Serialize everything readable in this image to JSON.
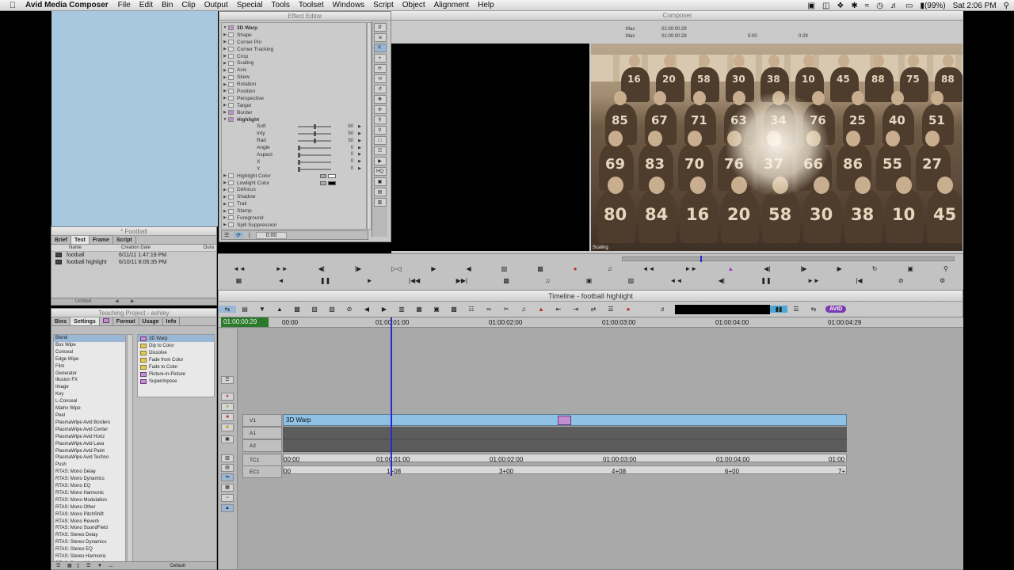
{
  "menubar": {
    "app_name": "Avid Media Composer",
    "items": [
      "File",
      "Edit",
      "Bin",
      "Clip",
      "Output",
      "Special",
      "Tools",
      "Toolset",
      "Windows",
      "Script",
      "Object",
      "Alignment",
      "Help"
    ],
    "battery": "(99%)",
    "clock": "Sat 2:06 PM"
  },
  "bin": {
    "title": "* Football",
    "tabs": [
      "Brief",
      "Text",
      "Frame",
      "Script"
    ],
    "columns": [
      "Name",
      "Creation Date",
      "Dura"
    ],
    "rows": [
      {
        "name": "football",
        "date": "6/11/11 1:47:19 PM"
      },
      {
        "name": "football highlight",
        "date": "6/10/11 8:05:35 PM"
      }
    ],
    "status": "Untitled"
  },
  "project": {
    "title": "Teaching Project - ashley",
    "tabs": [
      "Bins",
      "Settings",
      "",
      "Format",
      "Usage",
      "Info"
    ],
    "categories": [
      "Blend",
      "Box Wipe",
      "Conceal",
      "Edge Wipe",
      "Film",
      "Generator",
      "Illusion FX",
      "Image",
      "Key",
      "L-Conceal",
      "Matrix Wipe",
      "Peel",
      "PlasmaWipe Avid Borders",
      "PlasmaWipe Avid Center",
      "PlasmaWipe Avid Horiz",
      "PlasmaWipe Avid Lava",
      "PlasmaWipe Avid Paint",
      "PlasmaWipe Avid Techno",
      "Push",
      "RTAS: Mono Delay",
      "RTAS: Mono Dynamics",
      "RTAS: Mono EQ",
      "RTAS: Mono Harmonic",
      "RTAS: Mono Modulation",
      "RTAS: Mono Other",
      "RTAS: Mono PitchShift",
      "RTAS: Mono Reverb",
      "RTAS: Mono SoundField",
      "RTAS: Stereo Delay",
      "RTAS: Stereo Dynamics",
      "RTAS: Stereo EQ",
      "RTAS: Stereo Harmonic",
      "RTAS: Stereo Modulation"
    ],
    "effects": [
      "3D Warp",
      "Dip to Color",
      "Dissolve",
      "Fade from Color",
      "Fade to Color",
      "Picture-in-Picture",
      "Superimpose"
    ],
    "footer": "Default"
  },
  "effect_editor": {
    "title": "Effect Editor",
    "effect_name": "3D Warp",
    "params": [
      "Shape",
      "Corner Pin",
      "Corner Tracking",
      "Crop",
      "Scaling",
      "Axis",
      "Skew",
      "Rotation",
      "Position",
      "Perspective",
      "Target",
      "Border"
    ],
    "highlight_label": "Highlight",
    "highlight_params": [
      {
        "name": "Soft",
        "value": "50"
      },
      {
        "name": "Inty",
        "value": "50"
      },
      {
        "name": "Rad",
        "value": "50"
      },
      {
        "name": "Angle",
        "value": "0"
      },
      {
        "name": "Aspect",
        "value": "0"
      },
      {
        "name": "X",
        "value": "0"
      },
      {
        "name": "Y",
        "value": "0"
      }
    ],
    "more_params": [
      "Highlight Color",
      "Lowlight Color",
      "Defocus",
      "Shadow",
      "Trail",
      "Stamp",
      "Foreground",
      "Spill Suppression"
    ],
    "timecode": "0:00",
    "tools": [
      "HQ"
    ]
  },
  "composer": {
    "title": "Composer",
    "mas1": "Mas",
    "mas1_tc": "01:00:00:29",
    "mas2": "Mas",
    "mas2_tc": "01:00:00:29",
    "dur1": "5:00",
    "dur2": "0:29",
    "record_label": "Scaling",
    "jersey_numbers": [
      "16",
      "20",
      "58",
      "30",
      "38",
      "10",
      "45",
      "88",
      "75",
      "88",
      "85",
      "67",
      "71",
      "63",
      "34",
      "76",
      "25",
      "40",
      "51",
      "69",
      "83",
      "70",
      "76",
      "37",
      "66",
      "86",
      "55",
      "27",
      "80",
      "84"
    ]
  },
  "timeline": {
    "title": "Timeline - football highlight",
    "current_tc": "01:00:00:29",
    "ruler_marks": [
      "00:00",
      "01:00:01:00",
      "01:00:02:00",
      "01:00:03:00",
      "01:00:04:00",
      "01:00:04:29"
    ],
    "tracks": {
      "v1": "V1",
      "a1": "A1",
      "a2": "A2",
      "tc1": "TC1",
      "ec1": "EC1"
    },
    "clip_label": "3D Warp",
    "tc_marks": [
      "00:00",
      "01:00:01:00",
      "01:00:02:00",
      "01:00:03:00",
      "01:00:04:00",
      "01:00"
    ],
    "ec_marks": [
      "00",
      "1+08",
      "3+00",
      "4+08",
      "6+00",
      "7+"
    ],
    "avid_logo": "AVID"
  }
}
